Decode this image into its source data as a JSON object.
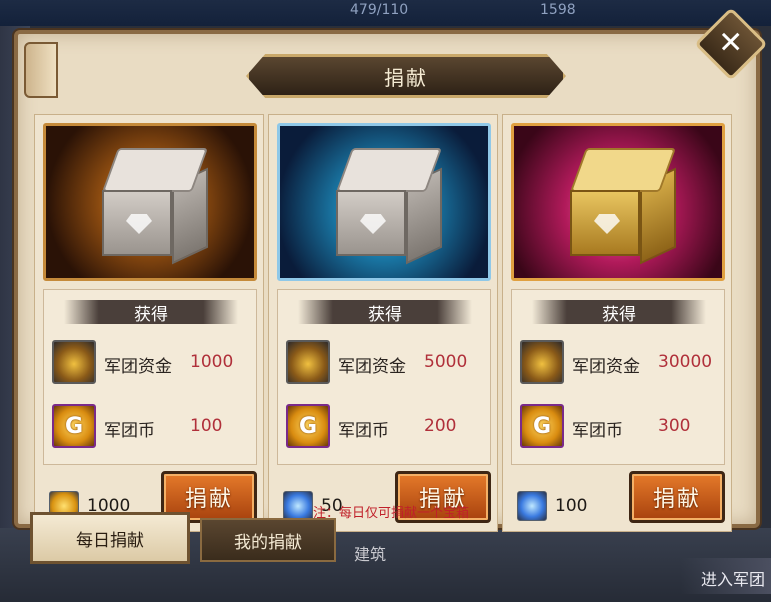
{
  "background": {
    "stat_energy": "479/110",
    "stat_gold": "1598",
    "build_label": "建筑",
    "enter_label": "进入军团"
  },
  "modal": {
    "title": "捐献",
    "close_icon": "close-icon",
    "note": "注：每日仅可捐献一个宝箱"
  },
  "cards": [
    {
      "reward_header": "获得",
      "rewards": [
        {
          "icon": "legion-fund-icon",
          "name": "军团资金",
          "value": "1000"
        },
        {
          "icon": "legion-coin-icon",
          "name": "军团币",
          "value": "100"
        }
      ],
      "cost_icon": "gold-coin-icon",
      "cost": "1000",
      "button": "捐献"
    },
    {
      "reward_header": "获得",
      "rewards": [
        {
          "icon": "legion-fund-icon",
          "name": "军团资金",
          "value": "5000"
        },
        {
          "icon": "legion-coin-icon",
          "name": "军团币",
          "value": "200"
        }
      ],
      "cost_icon": "diamond-icon",
      "cost": "50",
      "button": "捐献"
    },
    {
      "reward_header": "获得",
      "rewards": [
        {
          "icon": "legion-fund-icon",
          "name": "军团资金",
          "value": "30000"
        },
        {
          "icon": "legion-coin-icon",
          "name": "军团币",
          "value": "300"
        }
      ],
      "cost_icon": "diamond-icon",
      "cost": "100",
      "button": "捐献"
    }
  ],
  "tabs": [
    {
      "label": "每日捐献",
      "active": true
    },
    {
      "label": "我的捐献",
      "active": false
    }
  ],
  "colors": {
    "panel_bg": "#e9dcc3",
    "accent_red": "#b0303a",
    "button_orange": "#d8661e"
  }
}
